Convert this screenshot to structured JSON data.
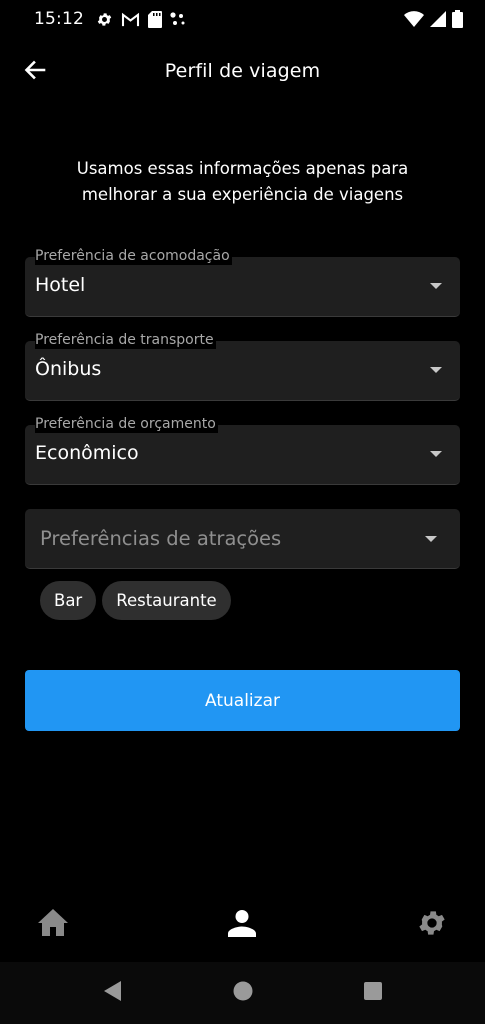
{
  "status_bar": {
    "time": "15:12",
    "left_icons": [
      "gear-icon",
      "gmail-icon",
      "sd-card-icon",
      "dots-icon"
    ],
    "right_icons": [
      "wifi-icon",
      "signal-icon",
      "battery-icon"
    ]
  },
  "app_bar": {
    "title": "Perfil de viagem",
    "back_icon": "arrow-back-icon"
  },
  "intro_text": "Usamos essas informações apenas para melhorar a sua experiência de viagens",
  "fields": {
    "accommodation": {
      "label": "Preferência de acomodação",
      "value": "Hotel"
    },
    "transport": {
      "label": "Preferência de transporte",
      "value": "Ônibus"
    },
    "budget": {
      "label": "Preferência de orçamento",
      "value": "Econômico"
    },
    "attractions": {
      "placeholder": "Preferências de atrações"
    }
  },
  "chips": [
    "Bar",
    "Restaurante"
  ],
  "update_button": "Atualizar",
  "bottom_nav": {
    "items": [
      {
        "icon": "home-icon",
        "color": "#8a8a8a"
      },
      {
        "icon": "person-icon",
        "color": "#ffffff"
      },
      {
        "icon": "settings-icon",
        "color": "#8a8a8a"
      }
    ]
  },
  "colors": {
    "background": "#000000",
    "field_background": "#1f1f1f",
    "primary": "#2196f3",
    "chip_background": "#2f2f2f"
  }
}
